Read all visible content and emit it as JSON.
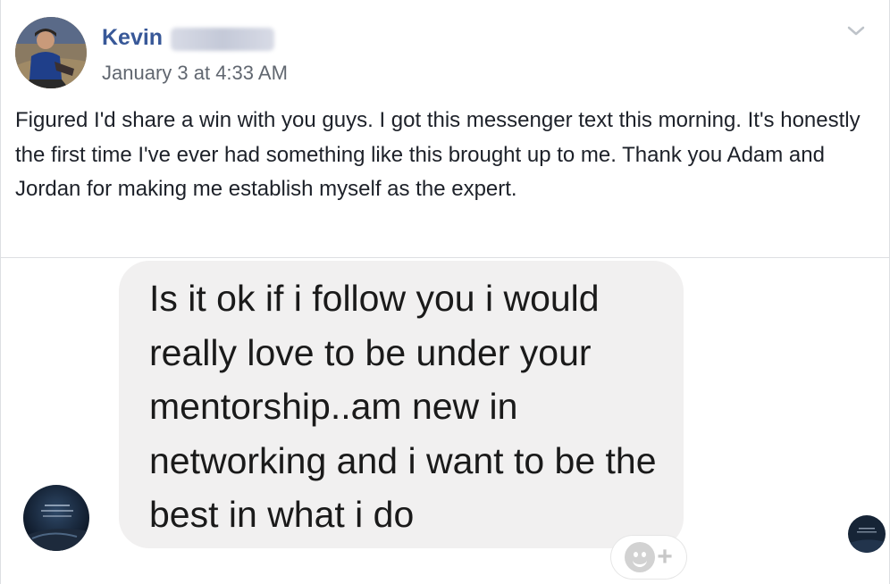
{
  "post": {
    "author_name": "Kevin",
    "timestamp": "January 3 at 4:33 AM",
    "text": "Figured I'd share a win with you guys. I got this messenger text this morning. It's honestly the first time I've ever had something like this brought up to me. Thank you Adam and Jordan for making me establish myself as the expert.",
    "options_icon": "chevron-down-icon"
  },
  "screenshot": {
    "message": "Is it ok if i follow you i would really love to be under your mentorship..am new in networking and i want to be the best in what i do",
    "reaction_icon": "add-reaction-icon",
    "reaction_plus": "+"
  },
  "colors": {
    "author_link": "#385898",
    "bubble_bg": "#f1f0f0",
    "meta_text": "#616770"
  }
}
